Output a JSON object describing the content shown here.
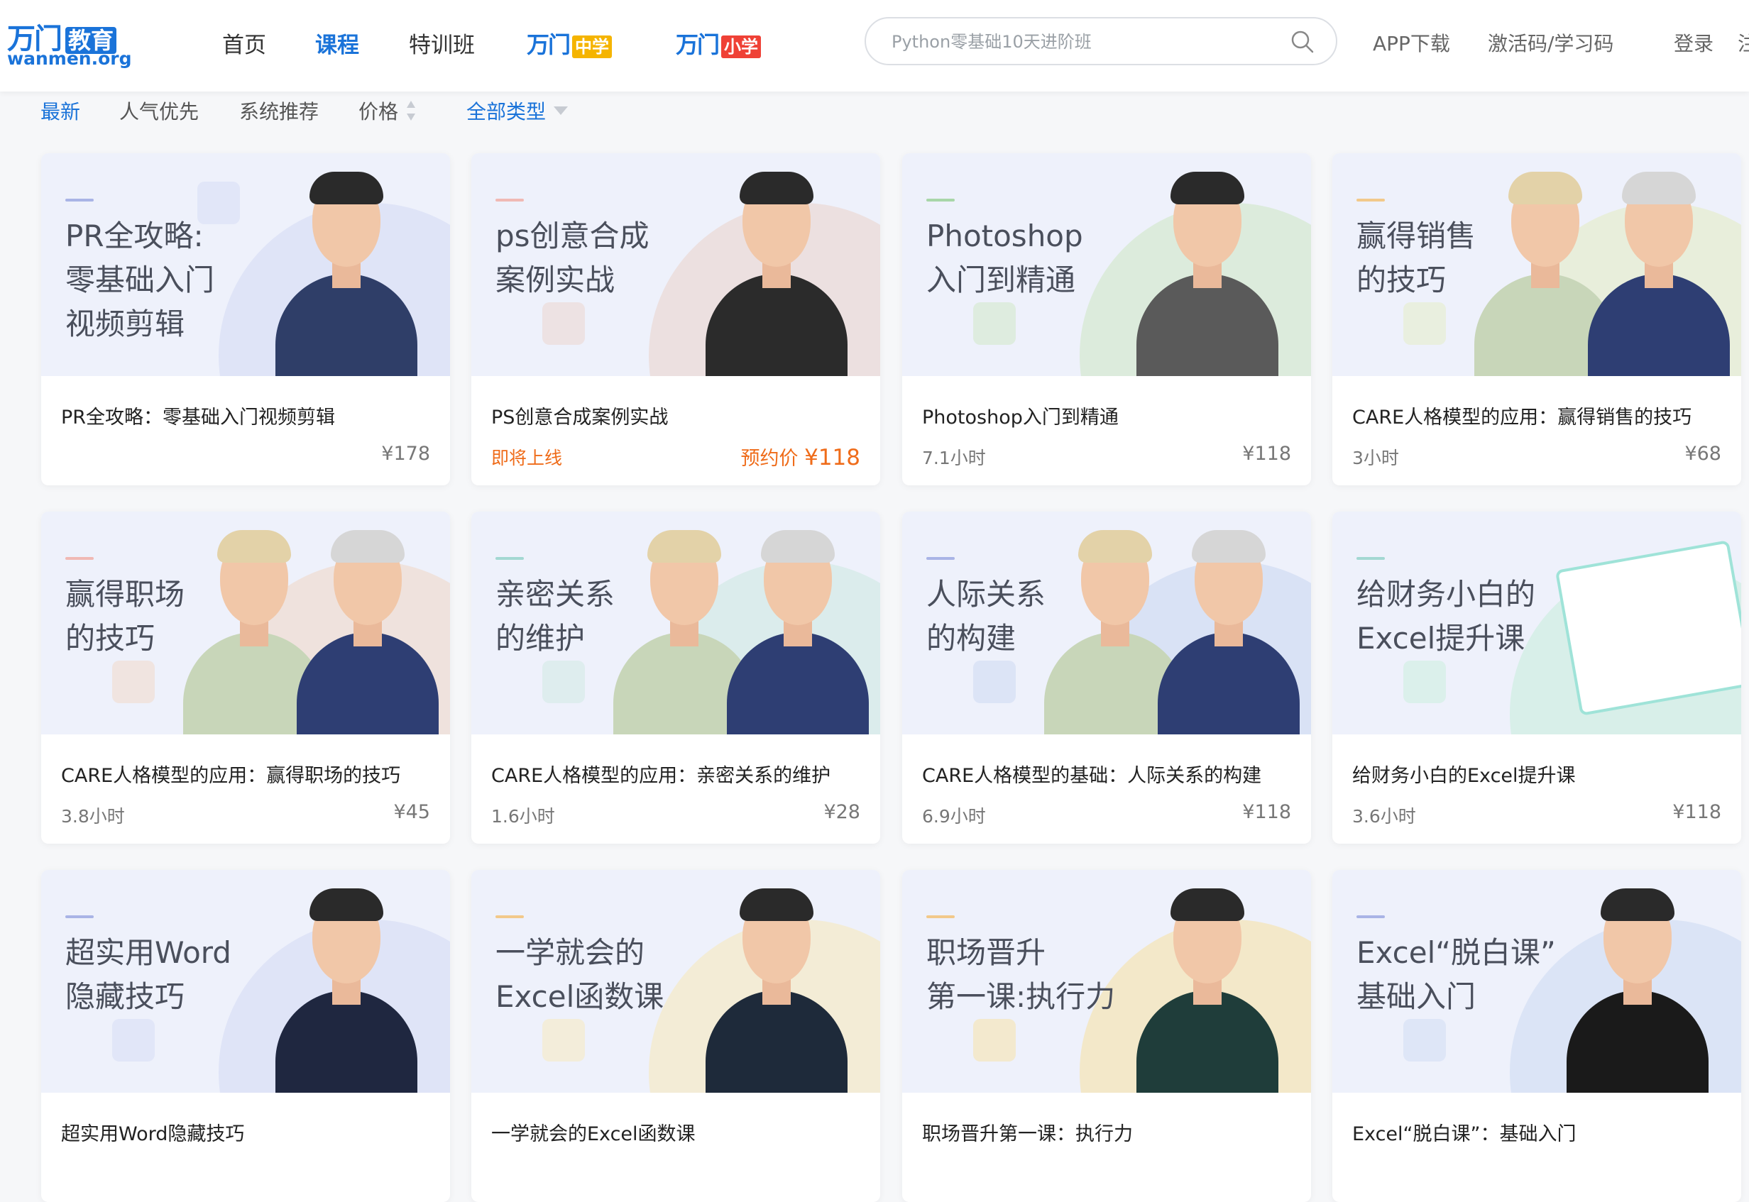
{
  "logo": {
    "cn": "万门",
    "cn_tag": "教育",
    "en": "wanmen.org"
  },
  "nav": [
    "首页",
    "课程",
    "特训班"
  ],
  "subbrands": [
    {
      "name": "万门",
      "tag": "中学"
    },
    {
      "name": "万门",
      "tag": "小学"
    }
  ],
  "search": {
    "placeholder": "Python零基础10天进阶班",
    "icon": "search-icon"
  },
  "header_links": [
    "APP下载",
    "激活码/学习码",
    "登录",
    "注"
  ],
  "filters": [
    "最新",
    "人气优先",
    "系统推荐",
    "价格",
    "全部类型"
  ],
  "colors": {
    "accent": "#1a73d9",
    "orange": "#ef6c1a",
    "middle": "#f5b400",
    "primary": "#ef4136"
  },
  "courses": [
    {
      "banner": "PR全攻略:\n零基础入门\n视频剪辑",
      "title": "PR全攻略：零基础入门视频剪辑",
      "meta": "",
      "price": "¥178",
      "icon": "video-icon"
    },
    {
      "banner": "ps创意合成\n案例实战",
      "title": "PS创意合成案例实战",
      "meta": "即将上线",
      "price_label": "预约价",
      "price": "¥118",
      "icon": "image-icon"
    },
    {
      "banner": "Photoshop\n入门到精通",
      "title": "Photoshop入门到精通",
      "meta": "7.1小时",
      "price": "¥118",
      "icon": "ps-icon"
    },
    {
      "banner": "赢得销售\n的技巧",
      "title": "CARE人格模型的应用：赢得销售的技巧",
      "meta": "3小时",
      "price": "¥68",
      "icon": "medal-icon"
    },
    {
      "banner": "赢得职场\n的技巧",
      "title": "CARE人格模型的应用：赢得职场的技巧",
      "meta": "3.8小时",
      "price": "¥45",
      "icon": "dots-icon"
    },
    {
      "banner": "亲密关系\n的维护",
      "title": "CARE人格模型的应用：亲密关系的维护",
      "meta": "1.6小时",
      "price": "¥28",
      "icon": "heart-icon"
    },
    {
      "banner": "人际关系\n的构建",
      "title": "CARE人格模型的基础：人际关系的构建",
      "meta": "6.9小时",
      "price": "¥118",
      "icon": "people-icon"
    },
    {
      "banner": "给财务小白的\nExcel提升课",
      "title": "给财务小白的Excel提升课",
      "meta": "3.6小时",
      "price": "¥118",
      "icon": "chart-icon"
    },
    {
      "banner": "超实用Word\n隐藏技巧",
      "title": "超实用Word隐藏技巧",
      "meta": "",
      "price": "",
      "icon": "word-icon"
    },
    {
      "banner": "一学就会的\nExcel函数课",
      "title": "一学就会的Excel函数课",
      "meta": "",
      "price": "",
      "icon": "excel-icon"
    },
    {
      "banner": "职场晋升\n第一课:执行力",
      "title": "职场晋升第一课：执行力",
      "meta": "",
      "price": "",
      "icon": "briefcase-icon"
    },
    {
      "banner": "Excel“脱白课”\n基础入门",
      "title": "Excel“脱白课”：基础入门",
      "meta": "",
      "price": "",
      "icon": "circle-icon"
    }
  ]
}
